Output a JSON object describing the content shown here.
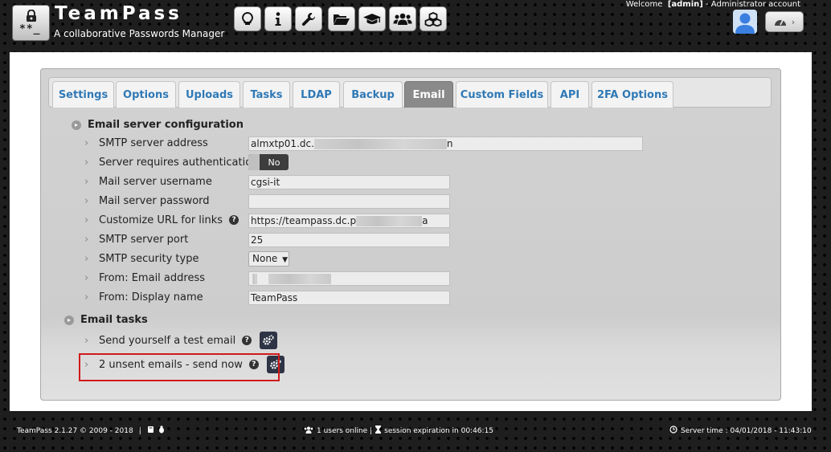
{
  "header": {
    "app_title": "TeamPass",
    "app_subtitle": "A collaborative Passwords Manager",
    "logo_stars": "**_",
    "welcome_prefix": "Welcome",
    "welcome_user": "[admin]",
    "welcome_suffix": "- Administrator account",
    "toolbar": [
      {
        "icon": "lightbulb-icon"
      },
      {
        "icon": "info-icon"
      },
      {
        "icon": "wrench-icon"
      },
      {
        "icon": "folder-open-icon"
      },
      {
        "icon": "graduation-cap-icon"
      },
      {
        "icon": "users-icon"
      },
      {
        "icon": "cubes-icon"
      }
    ]
  },
  "tabs": [
    {
      "label": "Settings",
      "active": false
    },
    {
      "label": "Options",
      "active": false
    },
    {
      "label": "Uploads",
      "active": false
    },
    {
      "label": "Tasks",
      "active": false
    },
    {
      "label": "LDAP",
      "active": false
    },
    {
      "label": "Backup",
      "active": false
    },
    {
      "label": "Email",
      "active": true
    },
    {
      "label": "Custom Fields",
      "active": false
    },
    {
      "label": "API",
      "active": false
    },
    {
      "label": "2FA Options",
      "active": false
    }
  ],
  "email_config": {
    "section_title": "Email server configuration",
    "smtp_address_label": "SMTP server address",
    "smtp_address_value": "almxtp01.dc.",
    "smtp_address_tail": "n",
    "auth_label": "Server requires authentication",
    "auth_toggle": "No",
    "username_label": "Mail server username",
    "username_value": "cgsi-it",
    "password_label": "Mail server password",
    "password_value": "",
    "url_label": "Customize URL for links",
    "url_value": "https://teampass.dc.p",
    "url_tail": "a",
    "port_label": "SMTP server port",
    "port_value": "25",
    "security_label": "SMTP security type",
    "security_value": "None",
    "from_email_label": "From: Email address",
    "from_email_value": "",
    "display_name_label": "From: Display name",
    "display_name_value": "TeamPass"
  },
  "email_tasks": {
    "section_title": "Email tasks",
    "test_email_label": "Send yourself a test email",
    "unsent_label": "2 unsent emails - send now"
  },
  "footer": {
    "version": "TeamPass 2.1.27 © 2009 - 2018",
    "separator": "|",
    "users_online": "1 users online |",
    "session": "session expiration in 00:46:15",
    "server_time": "Server time : 04/01/2018 - 11:43:10"
  },
  "colors": {
    "tab_text": "#2f79b6",
    "tab_active_bg": "#8a8a8a",
    "highlight_border": "#d11a1a",
    "gear_button_bg": "#2e3444"
  }
}
